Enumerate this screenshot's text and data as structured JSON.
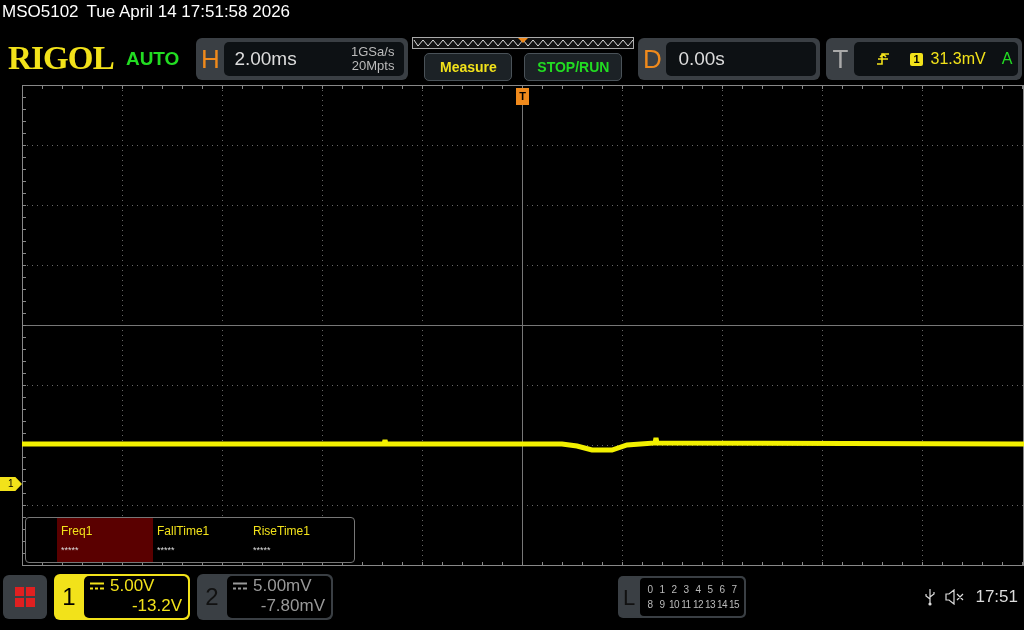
{
  "status_line": {
    "model": "MSO5102",
    "datetime": "Tue April 14 17:51:58 2026"
  },
  "logo": "RIGOL",
  "trigger_status": "AUTO",
  "horizontal": {
    "label": "H",
    "timebase": "2.00ms",
    "sample_rate": "1GSa/s",
    "memory_depth": "20Mpts"
  },
  "buttons": [
    {
      "label": "Measure",
      "kind": "measure"
    },
    {
      "label": "STOP/RUN",
      "kind": "run"
    }
  ],
  "delay": {
    "label": "D",
    "value": "0.00s"
  },
  "trigger": {
    "label": "T",
    "source": "1",
    "trigger_level": "31.3mV",
    "mode": "A"
  },
  "trigger_marker": "T",
  "channel_marker": "1",
  "measurements": [
    {
      "name": "Freq1",
      "value": "*****",
      "selected": true
    },
    {
      "name": "FallTime1",
      "value": "*****",
      "selected": false
    },
    {
      "name": "RiseTime1",
      "value": "*****",
      "selected": false
    }
  ],
  "channels": [
    {
      "number": "1",
      "scale": "5.00V",
      "offset": "-13.2V",
      "active": true
    },
    {
      "number": "2",
      "scale": "5.00mV",
      "offset": "-7.80mV",
      "active": false
    }
  ],
  "logic": {
    "label": "L",
    "rows": [
      [
        "0",
        "1",
        "2",
        "3",
        "4",
        "5",
        "6",
        "7"
      ],
      [
        "8",
        "9",
        "10",
        "11",
        "12",
        "13",
        "14",
        "15"
      ]
    ]
  },
  "clock": "17:51"
}
